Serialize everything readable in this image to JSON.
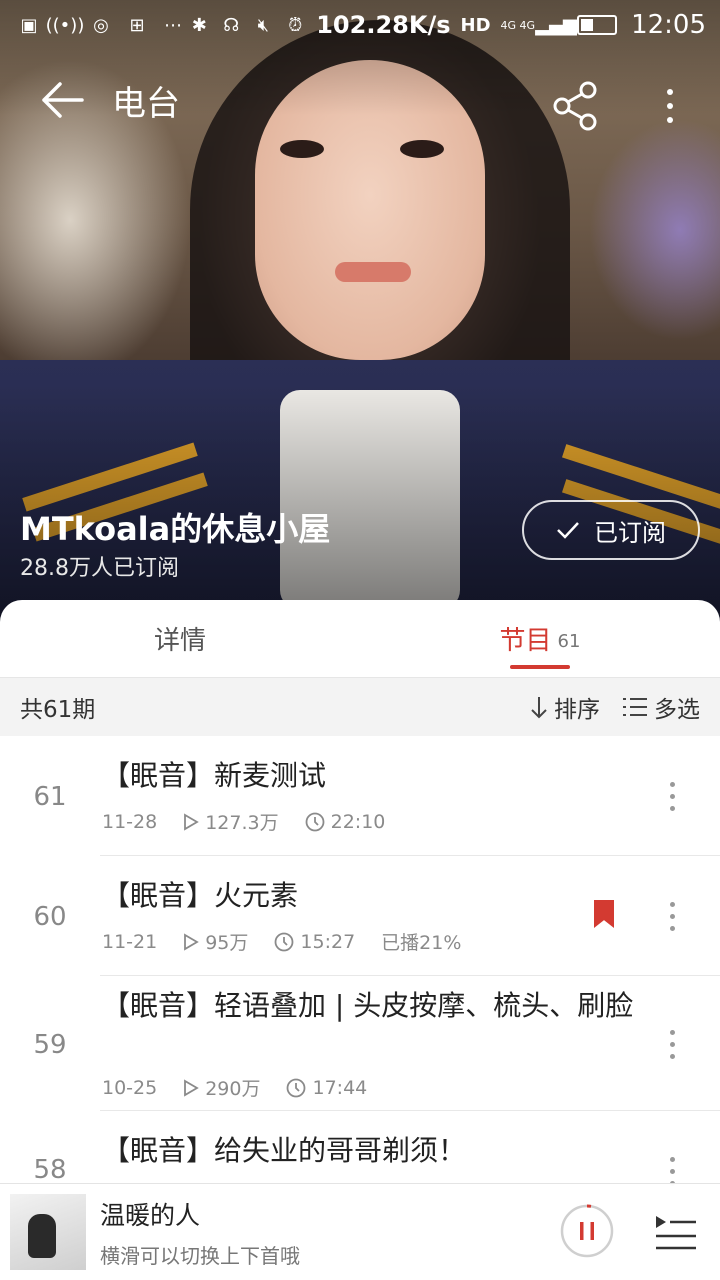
{
  "status_bar": {
    "speed": "102.28K/s",
    "network": "HD",
    "net_type": "4G 4G",
    "time": "12:05"
  },
  "nav": {
    "title": "电台"
  },
  "channel": {
    "title": "MTkoala的休息小屋",
    "subscribers": "28.8万人已订阅",
    "subscribe_label": "已订阅"
  },
  "tabs": [
    {
      "label": "详情",
      "count": ""
    },
    {
      "label": "节目",
      "count": "61"
    }
  ],
  "listbar": {
    "total": "共61期",
    "sort_label": "排序",
    "multi_label": "多选"
  },
  "episodes": [
    {
      "num": "61",
      "title": "【眠音】新麦测试",
      "date": "11-28",
      "plays": "127.3万",
      "duration": "22:10",
      "progress": ""
    },
    {
      "num": "60",
      "title": "【眠音】火元素",
      "date": "11-21",
      "plays": "95万",
      "duration": "15:27",
      "progress": "已播21%"
    },
    {
      "num": "59",
      "title": "【眠音】轻语叠加 | 头皮按摩、梳头、刷脸",
      "date": "10-25",
      "plays": "290万",
      "duration": "17:44",
      "progress": ""
    },
    {
      "num": "58",
      "title": "【眠音】给失业的哥哥剃须！",
      "date": "",
      "plays": "",
      "duration": "",
      "progress": ""
    }
  ],
  "player": {
    "song": "温暖的人",
    "hint": "横滑可以切换上下首哦"
  },
  "colors": {
    "accent": "#d33a31"
  }
}
